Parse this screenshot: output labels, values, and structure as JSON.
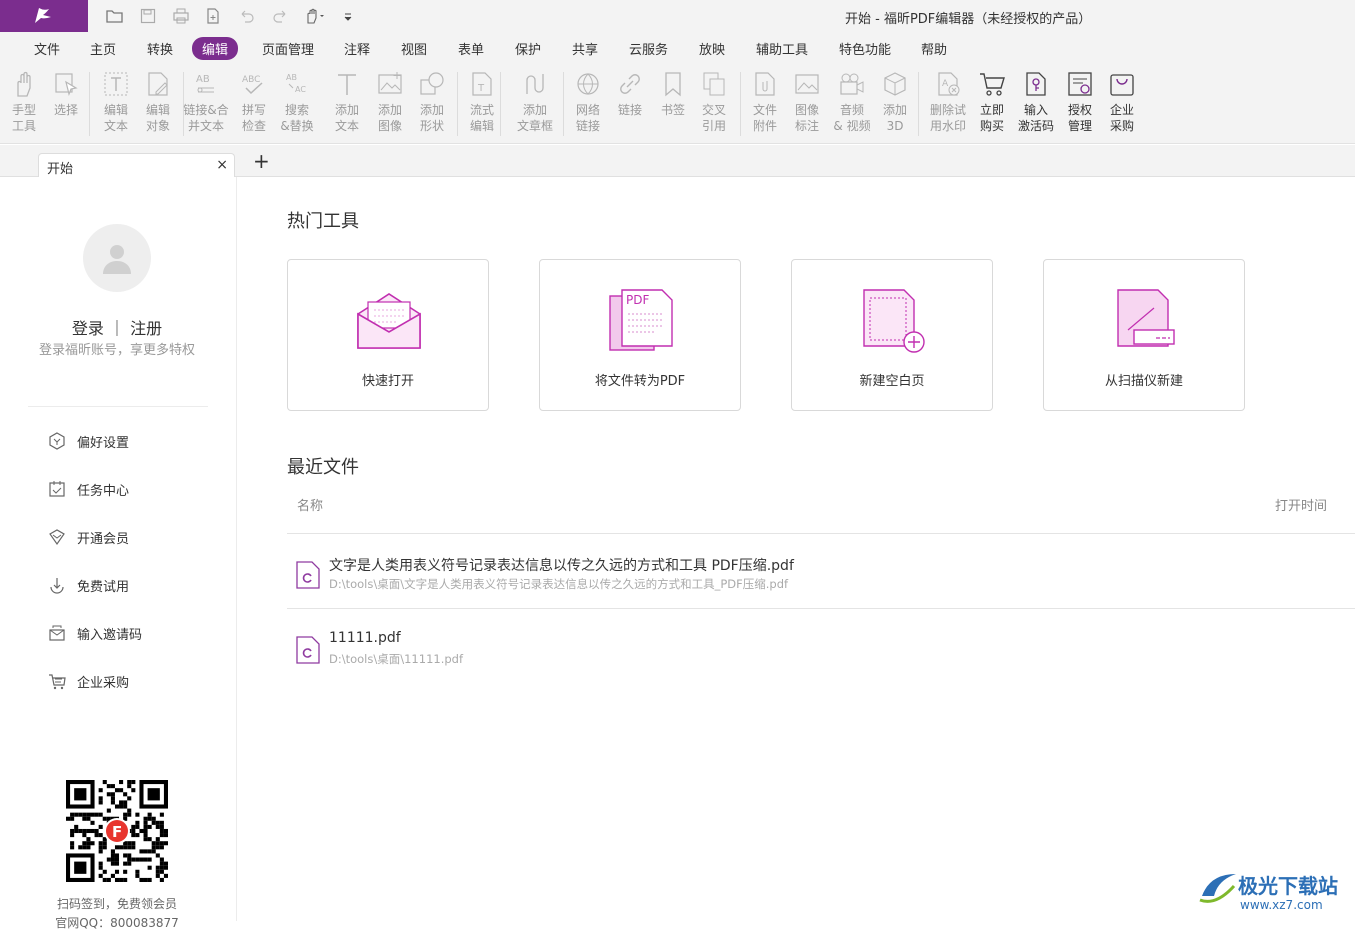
{
  "window": {
    "title": "开始 - 福昕PDF编辑器（未经授权的产品）"
  },
  "menu": [
    "文件",
    "主页",
    "转换",
    "编辑",
    "页面管理",
    "注释",
    "视图",
    "表单",
    "保护",
    "共享",
    "云服务",
    "放映",
    "辅助工具",
    "特色功能",
    "帮助"
  ],
  "menu_active": "编辑",
  "ribbon": [
    {
      "label": "手型\n工具",
      "icon": "hand-icon",
      "enabled": false
    },
    {
      "label": "选择",
      "icon": "select-arrow-icon",
      "enabled": false
    },
    {
      "label": "编辑\n文本",
      "icon": "edit-text-icon",
      "enabled": false
    },
    {
      "label": "编辑\n对象",
      "icon": "edit-object-icon",
      "enabled": false
    },
    {
      "label": "链接&合\n并文本",
      "icon": "link-merge-text-icon",
      "enabled": false
    },
    {
      "label": "拼写\n检查",
      "icon": "spell-check-icon",
      "enabled": false
    },
    {
      "label": "搜索\n&替换",
      "icon": "search-replace-icon",
      "enabled": false
    },
    {
      "label": "添加\n文本",
      "icon": "add-text-icon",
      "enabled": false
    },
    {
      "label": "添加\n图像",
      "icon": "add-image-icon",
      "enabled": false
    },
    {
      "label": "添加\n形状",
      "icon": "add-shape-icon",
      "enabled": false
    },
    {
      "label": "流式\n编辑",
      "icon": "flow-edit-icon",
      "enabled": false
    },
    {
      "label": "添加\n文章框",
      "icon": "article-box-icon",
      "enabled": false
    },
    {
      "label": "网络\n链接",
      "icon": "web-link-icon",
      "enabled": false
    },
    {
      "label": "链接",
      "icon": "link-icon",
      "enabled": false
    },
    {
      "label": "书签",
      "icon": "bookmark-icon",
      "enabled": false
    },
    {
      "label": "交叉\n引用",
      "icon": "cross-reference-icon",
      "enabled": false
    },
    {
      "label": "文件\n附件",
      "icon": "file-attachment-icon",
      "enabled": false
    },
    {
      "label": "图像\n标注",
      "icon": "image-annotation-icon",
      "enabled": false
    },
    {
      "label": "音频\n& 视频",
      "icon": "audio-video-icon",
      "enabled": false
    },
    {
      "label": "添加\n3D",
      "icon": "add-3d-icon",
      "enabled": false
    },
    {
      "label": "删除试\n用水印",
      "icon": "remove-watermark-icon",
      "enabled": false
    },
    {
      "label": "立即\n购买",
      "icon": "cart-icon",
      "enabled": true
    },
    {
      "label": "输入\n激活码",
      "icon": "activation-code-icon",
      "enabled": true
    },
    {
      "label": "授权\n管理",
      "icon": "license-manage-icon",
      "enabled": true
    },
    {
      "label": "企业\n采购",
      "icon": "enterprise-bag-icon",
      "enabled": true
    }
  ],
  "tab": {
    "label": "开始",
    "close": "×",
    "add": "+"
  },
  "sidebar": {
    "login": "登录 ｜ 注册",
    "login_sub": "登录福昕账号，享更多特权",
    "items": [
      {
        "label": "偏好设置",
        "icon": "preferences-icon"
      },
      {
        "label": "任务中心",
        "icon": "task-center-icon"
      },
      {
        "label": "开通会员",
        "icon": "membership-icon"
      },
      {
        "label": "免费试用",
        "icon": "free-trial-icon"
      },
      {
        "label": "输入邀请码",
        "icon": "invite-code-icon"
      },
      {
        "label": "企业采购",
        "icon": "enterprise-purchase-icon"
      }
    ],
    "qr_caption": "扫码签到，免费领会员",
    "qr_caption2": "官网QQ：800083877"
  },
  "hot_tools": {
    "title": "热门工具",
    "cards": [
      {
        "label": "快速打开",
        "icon": "open-envelope-icon"
      },
      {
        "label": "将文件转为PDF",
        "icon": "convert-to-pdf-icon",
        "badge": "PDF"
      },
      {
        "label": "新建空白页",
        "icon": "new-blank-page-icon"
      },
      {
        "label": "从扫描仪新建",
        "icon": "scanner-icon"
      }
    ]
  },
  "recent": {
    "title": "最近文件",
    "col_name": "名称",
    "col_time": "打开时间",
    "files": [
      {
        "name": "文字是人类用表义符号记录表达信息以传之久远的方式和工具  PDF压缩.pdf",
        "path": "D:\\tools\\桌面\\文字是人类用表义符号记录表达信息以传之久远的方式和工具_PDF压缩.pdf"
      },
      {
        "name": "11111.pdf",
        "path": "D:\\tools\\桌面\\11111.pdf"
      }
    ]
  },
  "watermark": {
    "title": "极光下载站",
    "url": "www.xz7.com"
  },
  "colors": {
    "brand": "#7b2d8e",
    "accent_pink": "#c12fb0",
    "toolbar_bg": "#f3f3f3"
  }
}
